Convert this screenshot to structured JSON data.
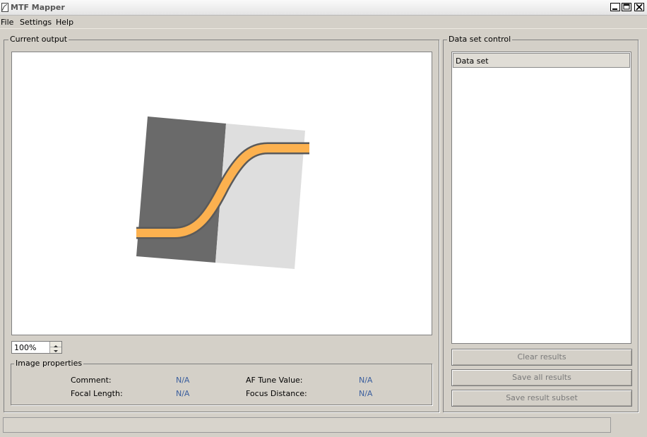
{
  "window": {
    "title": "MTF Mapper"
  },
  "menu": {
    "items": [
      "File",
      "Settings",
      "Help"
    ]
  },
  "current_output": {
    "title": "Current output",
    "zoom_value": "100%"
  },
  "image_properties": {
    "title": "Image properties",
    "comment_label": "Comment:",
    "comment_value": "N/A",
    "focal_length_label": "Focal Length:",
    "focal_length_value": "N/A",
    "af_tune_label": "AF Tune Value:",
    "af_tune_value": "N/A",
    "focus_distance_label": "Focus Distance:",
    "focus_distance_value": "N/A"
  },
  "data_set_control": {
    "title": "Data set control",
    "list_header": "Data set",
    "buttons": {
      "clear": "Clear results",
      "save_all": "Save all results",
      "save_subset": "Save result subset"
    }
  },
  "colors": {
    "accent_curve": "#fcb14f",
    "dark_region": "#6a6a6a",
    "light_region": "#dedede",
    "na_value": "#3b5f9e"
  }
}
